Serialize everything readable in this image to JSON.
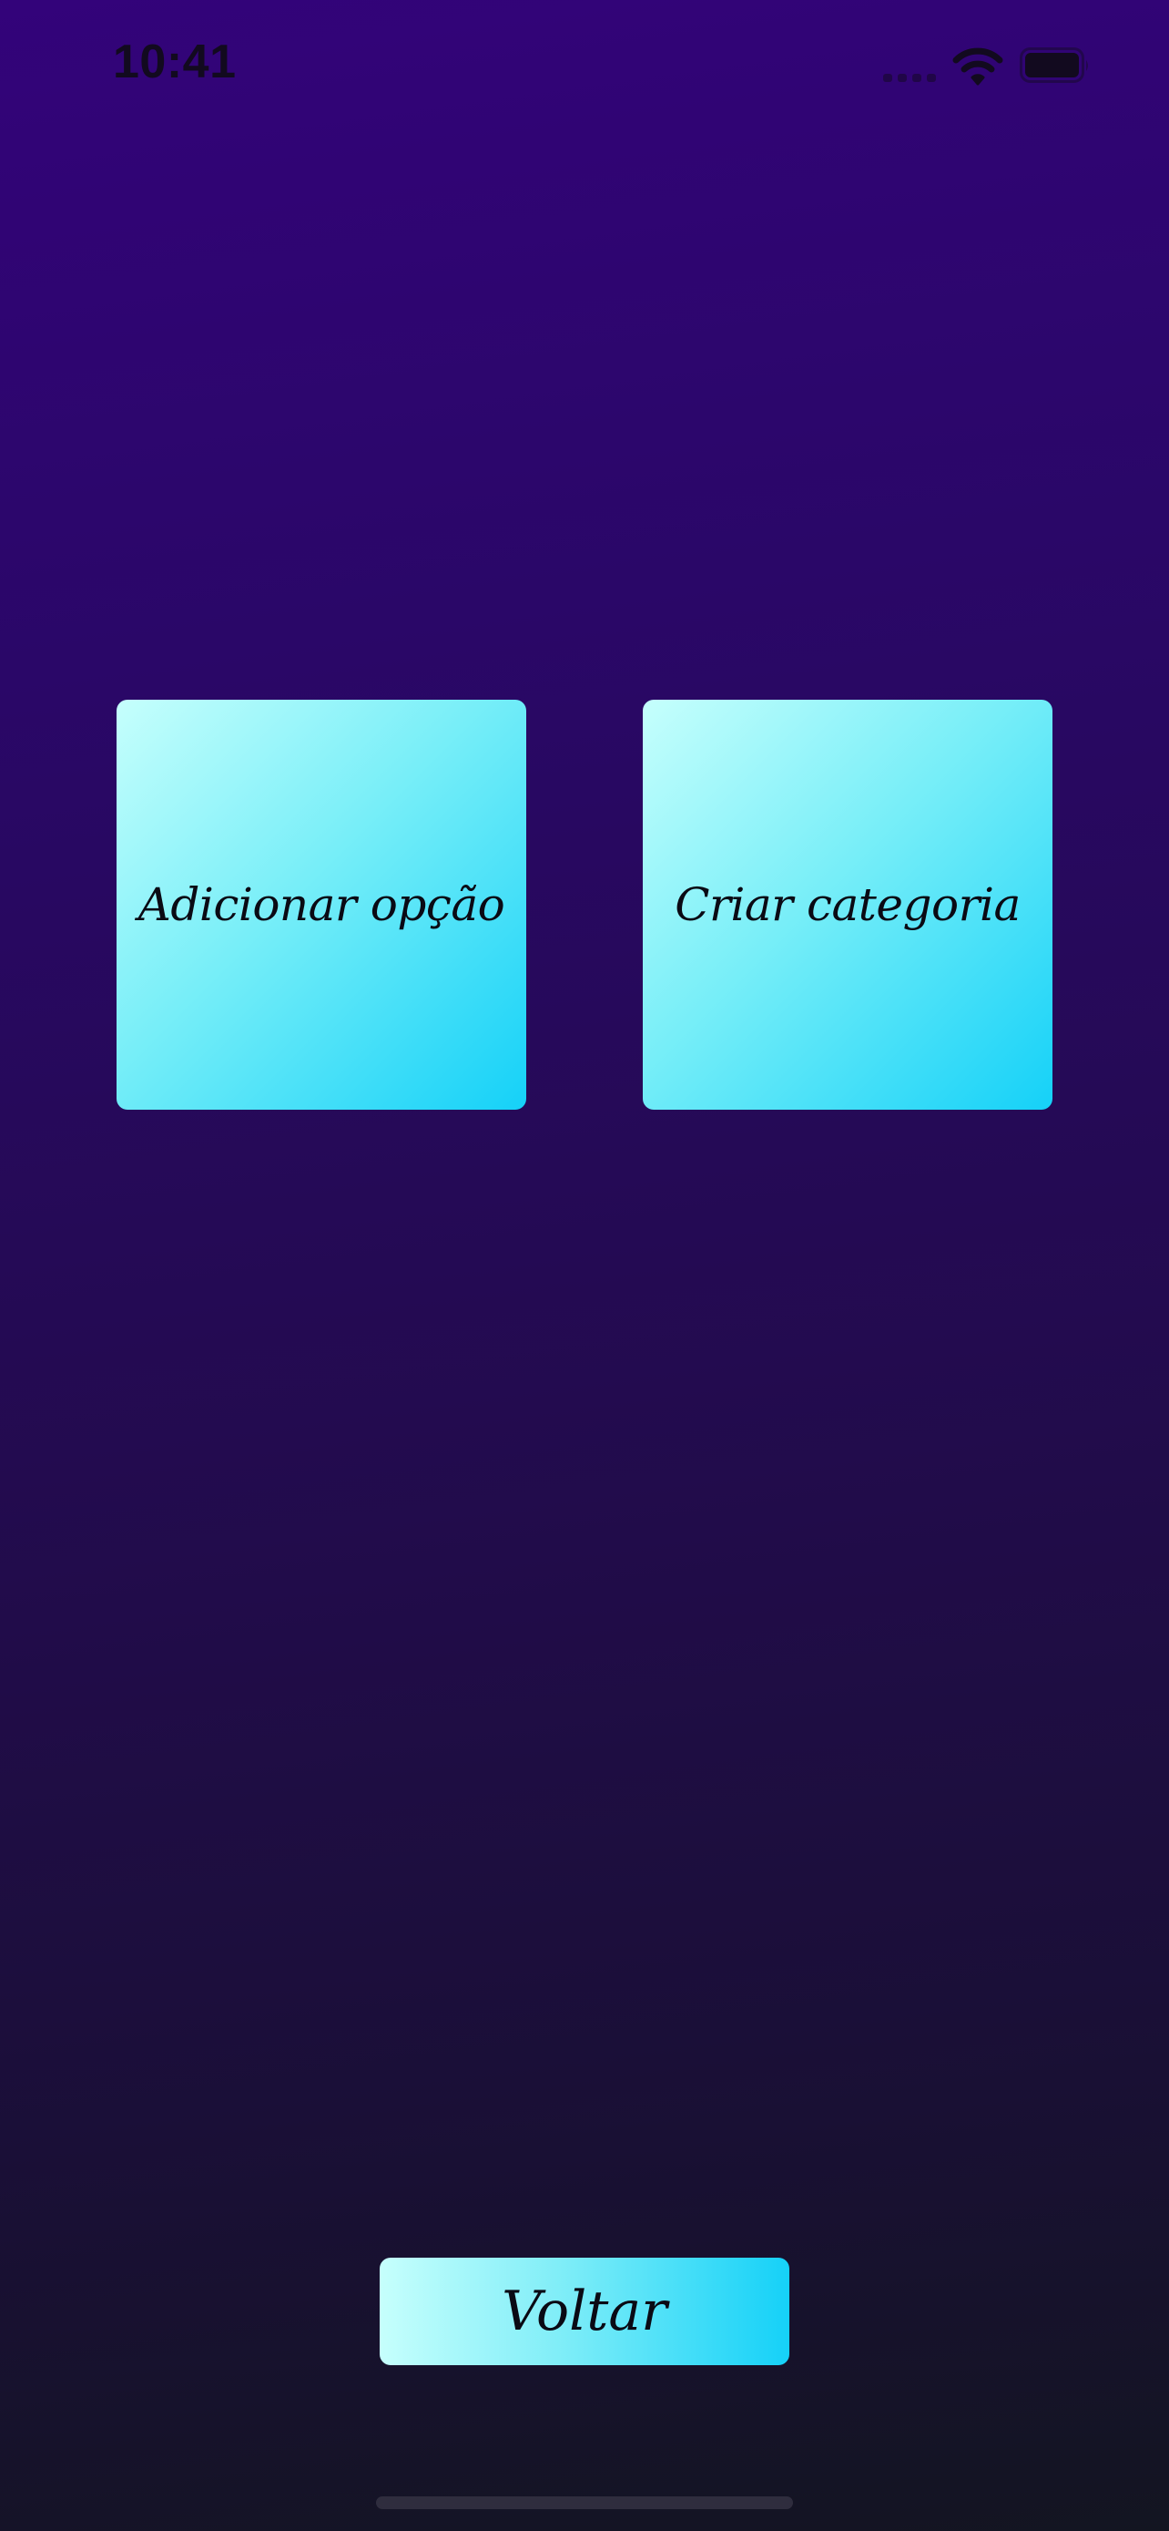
{
  "status_bar": {
    "time": "10:41"
  },
  "actions": [
    {
      "label": "Adicionar opção"
    },
    {
      "label": "Criar categoria"
    }
  ],
  "footer": {
    "back_label": "Voltar"
  },
  "icons": {
    "signal": "cellular-signal-icon",
    "wifi": "wifi-icon",
    "battery": "battery-icon"
  },
  "colors": {
    "background_top": "#33037a",
    "background_bottom": "#131521",
    "button_light": "#c6fffc",
    "button_dark": "#15d1f8",
    "text": "#0a0a14"
  }
}
